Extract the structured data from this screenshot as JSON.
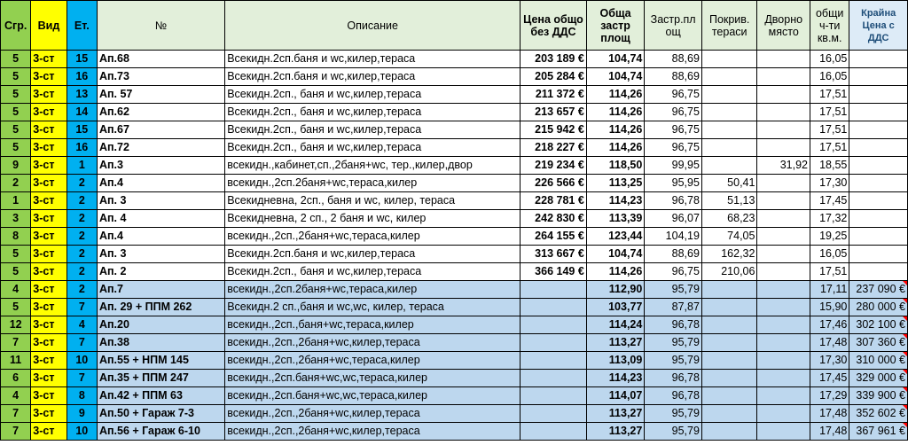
{
  "headers": {
    "grp": "Сгр.",
    "vid": "Вид",
    "et": "Ет.",
    "no": "№",
    "desc": "Описание",
    "price": "Цена общо без ДДС",
    "area": "Обща застр площ",
    "built": "Застр.пл ощ",
    "terr": "Покрив. тераси",
    "yard": "Дворно място",
    "common": "общи ч-ти кв.м.",
    "final": "Крайна Цена с ДДС"
  },
  "rows": [
    {
      "grp": "5",
      "vid": "3-ст",
      "et": "15",
      "no": "Ап.68",
      "desc": "Всекидн.2сп.баня и wc,килер,тераса",
      "price": "203 189 €",
      "area": "104,74",
      "built": "88,69",
      "terr": "",
      "yard": "",
      "common": "16,05",
      "final": "",
      "blue": false
    },
    {
      "grp": "5",
      "vid": "3-ст",
      "et": "16",
      "no": "Ап.73",
      "desc": "Всекидн.2сп.баня и wc,килер,тераса",
      "price": "205 284 €",
      "area": "104,74",
      "built": "88,69",
      "terr": "",
      "yard": "",
      "common": "16,05",
      "final": "",
      "blue": false
    },
    {
      "grp": "5",
      "vid": "3-ст",
      "et": "13",
      "no": "Ап. 57",
      "desc": "Всекидн.2сп., баня и wc,килер,тераса",
      "price": "211 372 €",
      "area": "114,26",
      "built": "96,75",
      "terr": "",
      "yard": "",
      "common": "17,51",
      "final": "",
      "blue": false
    },
    {
      "grp": "5",
      "vid": "3-ст",
      "et": "14",
      "no": "Ап.62",
      "desc": "Всекидн.2сп., баня и wc,килер,тераса",
      "price": "213 657 €",
      "area": "114,26",
      "built": "96,75",
      "terr": "",
      "yard": "",
      "common": "17,51",
      "final": "",
      "blue": false
    },
    {
      "grp": "5",
      "vid": "3-ст",
      "et": "15",
      "no": "Ап.67",
      "desc": "Всекидн.2сп., баня и wc,килер,тераса",
      "price": "215 942 €",
      "area": "114,26",
      "built": "96,75",
      "terr": "",
      "yard": "",
      "common": "17,51",
      "final": "",
      "blue": false
    },
    {
      "grp": "5",
      "vid": "3-ст",
      "et": "16",
      "no": "Ап.72",
      "desc": "Всекидн.2сп., баня и wc,килер,тераса",
      "price": "218 227 €",
      "area": "114,26",
      "built": "96,75",
      "terr": "",
      "yard": "",
      "common": "17,51",
      "final": "",
      "blue": false
    },
    {
      "grp": "9",
      "vid": "3-ст",
      "et": "1",
      "no": "Ап.3",
      "desc": "всекидн.,кабинет,сп.,2баня+wc, тер.,килер,двор",
      "price": "219 234 €",
      "area": "118,50",
      "built": "99,95",
      "terr": "",
      "yard": "31,92",
      "common": "18,55",
      "final": "",
      "blue": false
    },
    {
      "grp": "2",
      "vid": "3-ст",
      "et": "2",
      "no": "Ап.4",
      "desc": "всекидн.,2сп.2баня+wc,тераса,килер",
      "price": "226 566 €",
      "area": "113,25",
      "built": "95,95",
      "terr": "50,41",
      "yard": "",
      "common": "17,30",
      "final": "",
      "blue": false
    },
    {
      "grp": "1",
      "vid": "3-ст",
      "et": "2",
      "no": "Ап. 3",
      "desc": "Всекидневна, 2сп., баня и wc, килер, тераса",
      "price": "228 781 €",
      "area": "114,23",
      "built": "96,78",
      "terr": "51,13",
      "yard": "",
      "common": "17,45",
      "final": "",
      "blue": false
    },
    {
      "grp": "3",
      "vid": "3-ст",
      "et": "2",
      "no": "Ап. 4",
      "desc": "Всекидневна, 2 сп., 2 баня и wc, килер",
      "price": "242 830 €",
      "area": "113,39",
      "built": "96,07",
      "terr": "68,23",
      "yard": "",
      "common": "17,32",
      "final": "",
      "blue": false
    },
    {
      "grp": "8",
      "vid": "3-ст",
      "et": "2",
      "no": "Ап.4",
      "desc": "всекидн.,2сп.,2баня+wc,тераса,килер",
      "price": "264 155 €",
      "area": "123,44",
      "built": "104,19",
      "terr": "74,05",
      "yard": "",
      "common": "19,25",
      "final": "",
      "blue": false
    },
    {
      "grp": "5",
      "vid": "3-ст",
      "et": "2",
      "no": "Ап. 3",
      "desc": "Всекидн.2сп.баня и wc,килер,тераса",
      "price": "313 667 €",
      "area": "104,74",
      "built": "88,69",
      "terr": "162,32",
      "yard": "",
      "common": "16,05",
      "final": "",
      "blue": false
    },
    {
      "grp": "5",
      "vid": "3-ст",
      "et": "2",
      "no": "Ап. 2",
      "desc": "Всекидн.2сп., баня и wc,килер,тераса",
      "price": "366 149 €",
      "area": "114,26",
      "built": "96,75",
      "terr": "210,06",
      "yard": "",
      "common": "17,51",
      "final": "",
      "blue": false
    },
    {
      "grp": "4",
      "vid": "3-ст",
      "et": "2",
      "no": "Ап.7",
      "desc": "всекидн.,2сп.2баня+wc,тераса,килер",
      "price": "",
      "area": "112,90",
      "built": "95,79",
      "terr": "",
      "yard": "",
      "common": "17,11",
      "final": "237 090 €",
      "blue": true
    },
    {
      "grp": "5",
      "vid": "3-ст",
      "et": "7",
      "no": "Ап. 29 + ППМ 262",
      "desc": "Всекидн.2 сп.,баня и wc,wc, килер, тераса",
      "price": "",
      "area": "103,77",
      "built": "87,87",
      "terr": "",
      "yard": "",
      "common": "15,90",
      "final": "280 000 €",
      "blue": true
    },
    {
      "grp": "12",
      "vid": "3-ст",
      "et": "4",
      "no": "Ап.20",
      "desc": "всекидн.,2сп.,баня+wc,тераса,килер",
      "price": "",
      "area": "114,24",
      "built": "96,78",
      "terr": "",
      "yard": "",
      "common": "17,46",
      "final": "302 100 €",
      "blue": true
    },
    {
      "grp": "7",
      "vid": "3-ст",
      "et": "7",
      "no": "Ап.38",
      "desc": "всекидн.,2сп.,2баня+wc,килер,тераса",
      "price": "",
      "area": "113,27",
      "built": "95,79",
      "terr": "",
      "yard": "",
      "common": "17,48",
      "final": "307 360 €",
      "blue": true
    },
    {
      "grp": "11",
      "vid": "3-ст",
      "et": "10",
      "no": "Ап.55 + НПМ 145",
      "desc": "всекидн.,2сп.,2баня+wc,тераса,килер",
      "price": "",
      "area": "113,09",
      "built": "95,79",
      "terr": "",
      "yard": "",
      "common": "17,30",
      "final": "310 000 €",
      "blue": true
    },
    {
      "grp": "6",
      "vid": "3-ст",
      "et": "7",
      "no": "Ап.35 + ППМ 247",
      "desc": "всекидн.,2сп.баня+wc,wc,тераса,килер",
      "price": "",
      "area": "114,23",
      "built": "96,78",
      "terr": "",
      "yard": "",
      "common": "17,45",
      "final": "329 000 €",
      "blue": true
    },
    {
      "grp": "4",
      "vid": "3-ст",
      "et": "8",
      "no": "Ап.42 + ППМ 63",
      "desc": "всекидн.,2сп.баня+wc,wc,тераса,килер",
      "price": "",
      "area": "114,07",
      "built": "96,78",
      "terr": "",
      "yard": "",
      "common": "17,29",
      "final": "339 900 €",
      "blue": true
    },
    {
      "grp": "7",
      "vid": "3-ст",
      "et": "9",
      "no": "Ап.50 + Гараж 7-3",
      "desc": "всекидн.,2сп.,2баня+wc,килер,тераса",
      "price": "",
      "area": "113,27",
      "built": "95,79",
      "terr": "",
      "yard": "",
      "common": "17,48",
      "final": "352 602 €",
      "blue": true
    },
    {
      "grp": "7",
      "vid": "3-ст",
      "et": "10",
      "no": "Ап.56 + Гараж 6-10",
      "desc": "всекидн.,2сп.,2баня+wc,килер,тераса",
      "price": "",
      "area": "113,27",
      "built": "95,79",
      "terr": "",
      "yard": "",
      "common": "17,48",
      "final": "367 961 €",
      "blue": true
    }
  ]
}
